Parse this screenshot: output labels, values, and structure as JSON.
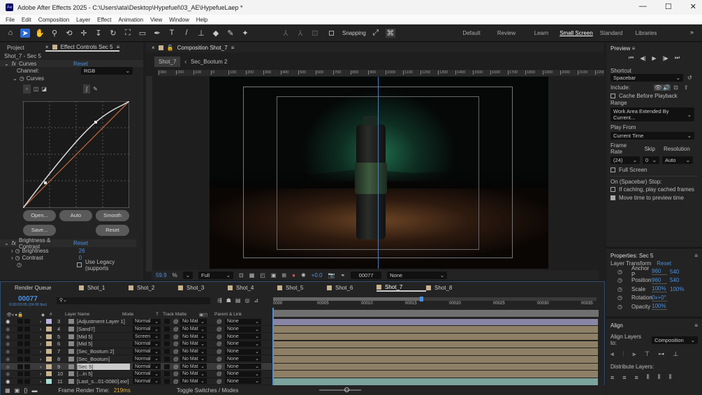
{
  "app": {
    "title": "Adobe After Effects 2025 - C:\\Users\\ata\\Desktop\\Hypefuel\\03_AE\\HypefueLaep *",
    "logo": "Ae"
  },
  "menu": [
    "File",
    "Edit",
    "Composition",
    "Layer",
    "Effect",
    "Animation",
    "View",
    "Window",
    "Help"
  ],
  "toolbar": {
    "snapping_label": "Snapping",
    "tools": [
      "home-icon",
      "selection-icon",
      "hand-icon",
      "zoom-icon",
      "orbit-icon",
      "pan-icon",
      "dolly-icon",
      "rotate-icon",
      "anchor-icon",
      "rectangle-icon",
      "pen-icon",
      "type-icon",
      "brush-icon",
      "clone-stamp-icon",
      "eraser-icon",
      "roto-brush-icon",
      "puppet-icon"
    ]
  },
  "workspaces": [
    "Default",
    "Review",
    "Learn",
    "Small Screen",
    "Standard",
    "Libraries"
  ],
  "workspace_active": "Small Screen",
  "left_panel": {
    "tabs": [
      "Project",
      "Effect Controls Sec 5"
    ],
    "layer_path": "Shot_7 - Sec 5",
    "curves": {
      "name": "Curves",
      "reset": "Reset",
      "channel_label": "Channel:",
      "channel_value": "RGB",
      "sub_label": "Curves",
      "buttons": {
        "open": "Open...",
        "auto": "Auto",
        "smooth": "Smooth",
        "save": "Save...",
        "reset": "Reset"
      }
    },
    "bc": {
      "name": "Brightness & Contrast",
      "reset": "Reset",
      "brightness_label": "Brightness",
      "brightness_value": "26",
      "contrast_label": "Contrast",
      "contrast_value": "0",
      "legacy_label": "Use Legacy (supports"
    }
  },
  "comp": {
    "tab": "Composition Shot_7",
    "crumbs": [
      "Shot_7",
      "Sec_Bootum 2"
    ],
    "ruler": [
      "300",
      "200",
      "100",
      "0",
      "100",
      "200",
      "300",
      "400",
      "500",
      "600",
      "700",
      "800",
      "900",
      "1000",
      "1100",
      "1200",
      "1300",
      "1400",
      "1500",
      "1600",
      "1700",
      "1800",
      "1900",
      "2000",
      "2100",
      "2200"
    ],
    "zoom": "59.9",
    "zoom_unit": "%",
    "resolution": "Full",
    "exposure": "+0.0",
    "timecode": "00077",
    "view": "None"
  },
  "preview": {
    "title": "Preview",
    "shortcut_label": "Shortcut",
    "shortcut": "Spacebar",
    "include_label": "Include:",
    "cache_label": "Cache Before Playback",
    "range_label": "Range",
    "range": "Work Area Extended By Current...",
    "play_from_label": "Play From",
    "play_from": "Current Time",
    "frame_rate_label": "Frame Rate",
    "frame_rate": "(24)",
    "skip_label": "Skip",
    "skip": "0",
    "resolution_label": "Resolution",
    "resolution": "Auto",
    "full_screen_label": "Full Screen",
    "stop_label": "On (Spacebar) Stop:",
    "if_caching_label": "If caching, play cached frames",
    "move_time_label": "Move time to preview time",
    "move_time_checked": true
  },
  "properties": {
    "title": "Properties: Sec 5",
    "group": "Layer Transform",
    "reset": "Reset",
    "rows": [
      {
        "label": "Anchor P",
        "v1": "960",
        "v2": "540"
      },
      {
        "label": "Position",
        "v1": "960",
        "v2": "540"
      },
      {
        "label": "Scale",
        "v1": "100%",
        "v2": "100%"
      },
      {
        "label": "Rotation",
        "v1": "0x+0°",
        "v2": ""
      },
      {
        "label": "Opacity",
        "v1": "100%",
        "v2": ""
      }
    ]
  },
  "align": {
    "title": "Align",
    "align_to_label": "Align Layers to:",
    "align_to": "Composition",
    "distribute_label": "Distribute Layers:"
  },
  "timeline": {
    "tabs": [
      "Render Queue",
      "Shot_1",
      "Shot_2",
      "Shot_3",
      "Shot_4",
      "Shot_5",
      "Shot_6",
      "Shot_7",
      "Shot_8"
    ],
    "active_tab": "Shot_7",
    "timecode": "00077",
    "timecode_sub": "0:00:03:05 (24.00 fps)",
    "headers": {
      "num": "#",
      "name": "Layer Name",
      "mode": "Mode",
      "t": "T",
      "matte": "Track Matte",
      "parent": "Parent & Link"
    },
    "ticks": [
      "0000",
      "00005",
      "00010",
      "00015",
      "00020",
      "00025",
      "00030",
      "00035"
    ],
    "layers": [
      {
        "num": "3",
        "name": "[Adjustment Layer 1]",
        "mode": "Normal",
        "matte": "No Mat",
        "parent": "None",
        "color": "#b9b2e0"
      },
      {
        "num": "4",
        "name": "[Sand7]",
        "mode": "Normal",
        "matte": "No Mat",
        "parent": "None",
        "color": "#c7b28f"
      },
      {
        "num": "5",
        "name": "[Mid 5]",
        "mode": "Screen",
        "matte": "No Mat",
        "parent": "None",
        "color": "#c7b28f"
      },
      {
        "num": "6",
        "name": "[Mid 5]",
        "mode": "Normal",
        "matte": "No Mat",
        "parent": "None",
        "color": "#c7b28f"
      },
      {
        "num": "7",
        "name": "[Sec_Bootum 2]",
        "mode": "Normal",
        "matte": "No Mat",
        "parent": "None",
        "color": "#c7b28f"
      },
      {
        "num": "8",
        "name": "[Sec_Bootum]",
        "mode": "Normal",
        "matte": "No Mat",
        "parent": "None",
        "color": "#c7b28f"
      },
      {
        "num": "9",
        "name": "[Sec 5]",
        "mode": "Normal",
        "matte": "No Mat",
        "parent": "None",
        "color": "#c7b28f"
      },
      {
        "num": "10",
        "name": "[...in 5]",
        "mode": "Normal",
        "matte": "No Mat",
        "parent": "None",
        "color": "#c7b28f"
      },
      {
        "num": "11",
        "name": "[Last_s...01-0080].exr]",
        "mode": "Normal",
        "matte": "No Mat",
        "parent": "None",
        "color": "#a8dcd4"
      }
    ],
    "render_time_label": "Frame Render Time:",
    "render_time": "219ms",
    "toggle_label": "Toggle Switches / Modes"
  },
  "colors": {
    "accent": "#2d6bd6",
    "blue_value": "#4a90e2",
    "track": "#8e8066"
  }
}
